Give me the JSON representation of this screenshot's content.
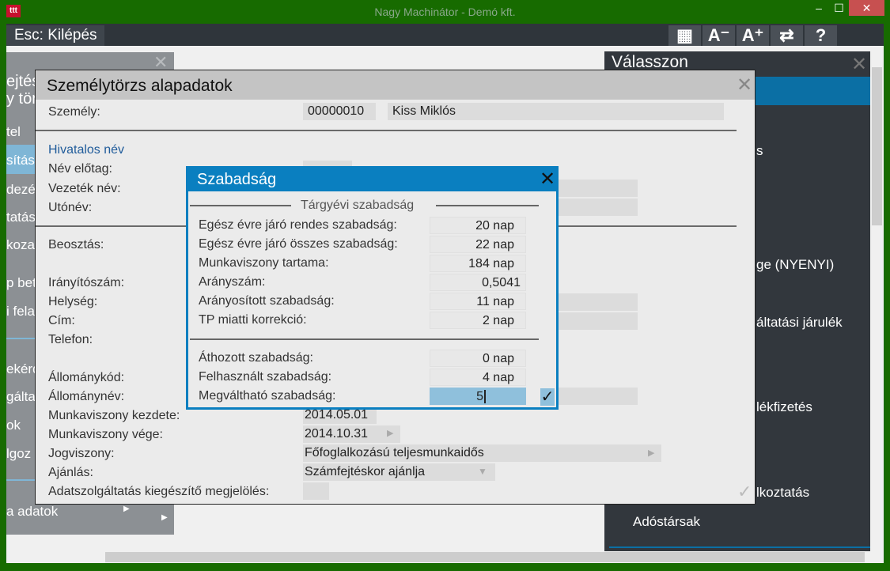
{
  "window": {
    "title": "Nagy Machinátor - Demó kft.",
    "app_icon": "ttt",
    "minimize": "‒",
    "maximize": "☐",
    "close": "✕"
  },
  "toolbar": {
    "esc_label": "Esc: Kilépés",
    "icons": [
      "grid-icon",
      "font-decrease-icon",
      "font-increase-icon",
      "swap-icon",
      "help-icon"
    ],
    "icon_glyphs": [
      "▦",
      "A⁻",
      "A⁺",
      "⇄",
      "?"
    ]
  },
  "left_panel": {
    "items": [
      "ejtés",
      "y tör",
      "tel",
      "sítás",
      "dezé",
      "tatás",
      "kozat",
      "p bet",
      "i fela",
      "ekérd",
      "gálta",
      "ok",
      "lgoz",
      "a adatok"
    ],
    "close": "✕"
  },
  "right_panel": {
    "title": "Válasszon",
    "close": "✕",
    "items": [
      "s",
      "ge (NYENYI)",
      "áltatási járulék",
      "lékfizetés",
      "lkoztatás",
      "Adóstársak"
    ]
  },
  "personnel_dialog": {
    "title": "Személytörzs alapadatok",
    "close": "✕",
    "person_label": "Személy:",
    "person_code": "00000010",
    "person_name": "Kiss Miklós",
    "official_name_heading": "Hivatalos név",
    "labels": {
      "prefix": "Név előtag:",
      "surname": "Vezeték név:",
      "given": "Utónév:",
      "position": "Beosztás:",
      "zip": "Irányítószám:",
      "city": "Helység:",
      "address": "Cím:",
      "phone": "Telefon:",
      "status_code": "Állománykód:",
      "status_name": "Állománynév:",
      "start": "Munkaviszony kezdete:",
      "end": "Munkaviszony vége:",
      "legal": "Jogviszony:",
      "recommend": "Ajánlás:",
      "supplement": "Adatszolgáltatás kiegészítő megjelölés:"
    },
    "values": {
      "start": "2014.05.01",
      "end": "2014.10.31",
      "legal": "Főfoglalkozású teljesmunkaidős",
      "recommend": "Számfejtéskor ajánlja"
    }
  },
  "leave_dialog": {
    "title": "Szabadság",
    "close": "✕",
    "section": "Tárgyévi szabadság",
    "rows": [
      {
        "label": "Egész évre járó rendes szabadság:",
        "value": "20 nap"
      },
      {
        "label": "Egész évre járó összes szabadság:",
        "value": "22 nap"
      },
      {
        "label": "Munkaviszony tartama:",
        "value": "184 nap"
      },
      {
        "label": "Arányszám:",
        "value": "0,5041"
      },
      {
        "label": "Arányosított szabadság:",
        "value": "11 nap"
      },
      {
        "label": "TP miatti korrekció:",
        "value": "2 nap"
      }
    ],
    "rows2": [
      {
        "label": "Áthozott szabadság:",
        "value": "0 nap"
      },
      {
        "label": "Felhasznált szabadság:",
        "value": "4 nap"
      },
      {
        "label": "Megváltható szabadság:",
        "value": "5"
      }
    ],
    "confirm": "✓"
  }
}
